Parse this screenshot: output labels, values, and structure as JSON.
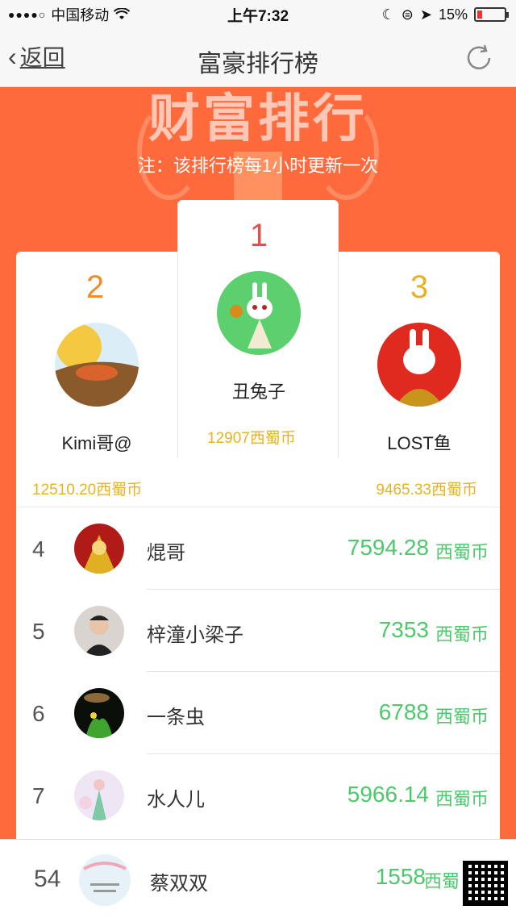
{
  "status_bar": {
    "carrier": "中国移动",
    "time": "上午7:32",
    "battery": "15%"
  },
  "nav": {
    "back_label": "返回",
    "title": "富豪排行榜"
  },
  "banner": {
    "title": "财富排行",
    "notice": "注：该排行榜每1小时更新一次"
  },
  "podium": {
    "first": {
      "rank": "1",
      "name": "丑兔子",
      "coins": "12907西蜀币"
    },
    "second": {
      "rank": "2",
      "name": "Kimi哥@",
      "coins": "12510.20西蜀币"
    },
    "third": {
      "rank": "3",
      "name": "LOST鱼",
      "coins": "9465.33西蜀币"
    }
  },
  "list": [
    {
      "rank": "4",
      "name": "焜哥",
      "value": "7594.28",
      "currency": "西蜀币"
    },
    {
      "rank": "5",
      "name": "梓潼小梁子",
      "value": "7353",
      "currency": "西蜀币"
    },
    {
      "rank": "6",
      "name": "一条虫",
      "value": "6788",
      "currency": "西蜀币"
    },
    {
      "rank": "7",
      "name": "水人儿",
      "value": "5966.14",
      "currency": "西蜀币"
    }
  ],
  "me": {
    "rank": "54",
    "name": "蔡双双",
    "value": "1558",
    "currency": "西蜀"
  },
  "colors": {
    "background": "#ff6a3d",
    "gold": "#e6b422",
    "green": "#4cc96a",
    "rank1": "#d9534f",
    "rank2": "#ef8d2a",
    "rank3": "#e6b422"
  }
}
